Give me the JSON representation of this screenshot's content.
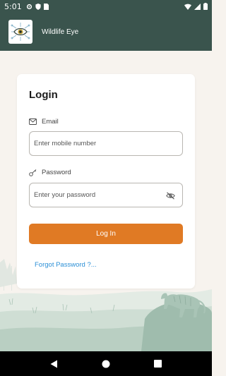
{
  "status_bar": {
    "time": "5:01"
  },
  "app_bar": {
    "title": "Wildlife Eye"
  },
  "login": {
    "title": "Login",
    "email_label": "Email",
    "email_placeholder": "Enter mobile number",
    "password_label": "Password",
    "password_placeholder": "Enter your password",
    "login_button": "Log In",
    "forgot_link": "Forgot Password ?..."
  },
  "colors": {
    "header": "#3a544d",
    "accent": "#e07a24",
    "link": "#2b8fd6",
    "background": "#f7f3ee"
  }
}
